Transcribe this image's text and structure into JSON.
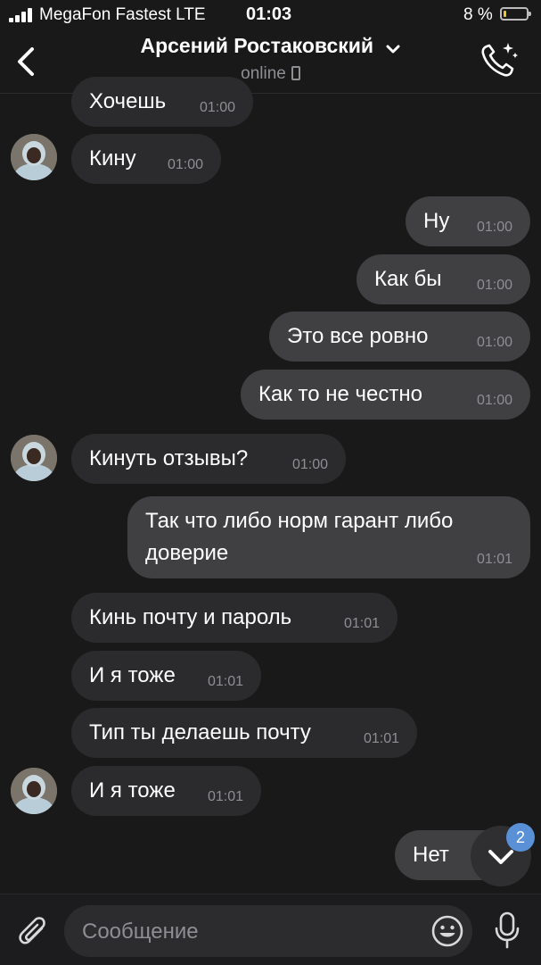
{
  "status_bar": {
    "carrier": "MegaFon Fastest  LTE",
    "time": "01:03",
    "battery": "8 %"
  },
  "header": {
    "name": "Арсений Ростаковский",
    "status": "online"
  },
  "messages": [
    {
      "text": "Хочешь",
      "time": "01:00",
      "dir": "in"
    },
    {
      "text": "Кину",
      "time": "01:00",
      "dir": "in"
    },
    {
      "text": "Ну",
      "time": "01:00",
      "dir": "out"
    },
    {
      "text": "Как бы",
      "time": "01:00",
      "dir": "out"
    },
    {
      "text": "Это все ровно",
      "time": "01:00",
      "dir": "out"
    },
    {
      "text": "Как то не честно",
      "time": "01:00",
      "dir": "out"
    },
    {
      "text": "Кинуть отзывы?",
      "time": "01:00",
      "dir": "in"
    },
    {
      "text": "Так что либо норм гарант либо\nдоверие",
      "time": "01:01",
      "dir": "out"
    },
    {
      "text": "Кинь почту и пароль",
      "time": "01:01",
      "dir": "in"
    },
    {
      "text": "И я тоже",
      "time": "01:01",
      "dir": "in"
    },
    {
      "text": "Тип ты делаешь почту",
      "time": "01:01",
      "dir": "in"
    },
    {
      "text": "И я тоже",
      "time": "01:01",
      "dir": "in"
    },
    {
      "text": "Нет",
      "time": "",
      "dir": "out"
    }
  ],
  "scroll_badge": "2",
  "composer": {
    "placeholder": "Сообщение"
  },
  "colors": {
    "background": "#19191a",
    "incoming_bubble": "#2b2b2d",
    "outgoing_bubble": "#404043",
    "time_text": "#8e8e93",
    "badge": "#5a91d6",
    "battery_low": "#f0c52b"
  }
}
